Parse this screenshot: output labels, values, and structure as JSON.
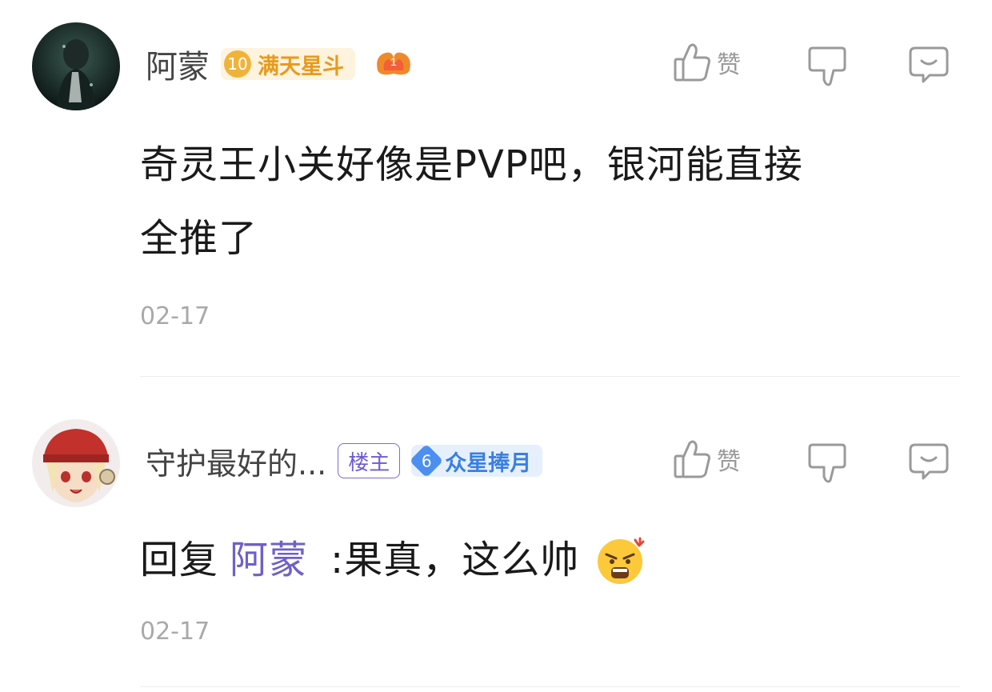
{
  "comments": [
    {
      "username": "阿蒙",
      "level": "10",
      "level_title": "满天星斗",
      "medal_number": "1",
      "like_label": "赞",
      "text_line1": "奇灵王小关好像是PVP吧，银河能直接",
      "text_line2": "全推了",
      "date": "02-17"
    },
    {
      "username": "守护最好的...",
      "owner_tag": "楼主",
      "level": "6",
      "level_title": "众星捧月",
      "like_label": "赞",
      "reply_prefix": "回复",
      "reply_target": "阿蒙",
      "reply_text": ":果真，这么帅",
      "date": "02-17"
    }
  ],
  "colors": {
    "accent_purple": "#6f60c8",
    "gold_badge": "#f0b33a",
    "blue_badge": "#4d8ff0",
    "muted": "#a9a9a9"
  }
}
